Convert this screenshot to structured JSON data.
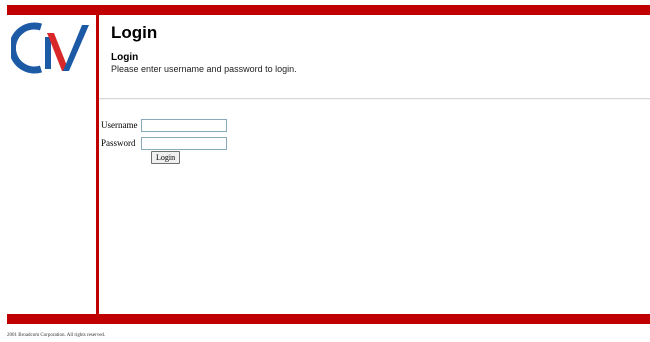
{
  "header": {
    "title": "Login",
    "section_title": "Login",
    "instructions": "Please enter username and password to login."
  },
  "form": {
    "username_label": "Username",
    "username_value": "",
    "password_label": "Password",
    "password_value": "",
    "login_button_label": "Login"
  },
  "footer": {
    "copyright": "2001 Broadcom Corporation. All rights reserved."
  },
  "logo": {
    "text": "CN",
    "icon": "cn-logo-icon"
  },
  "colors": {
    "accent_bar": "#c00000",
    "logo_blue": "#1c5aa6",
    "logo_red": "#d8282a"
  }
}
